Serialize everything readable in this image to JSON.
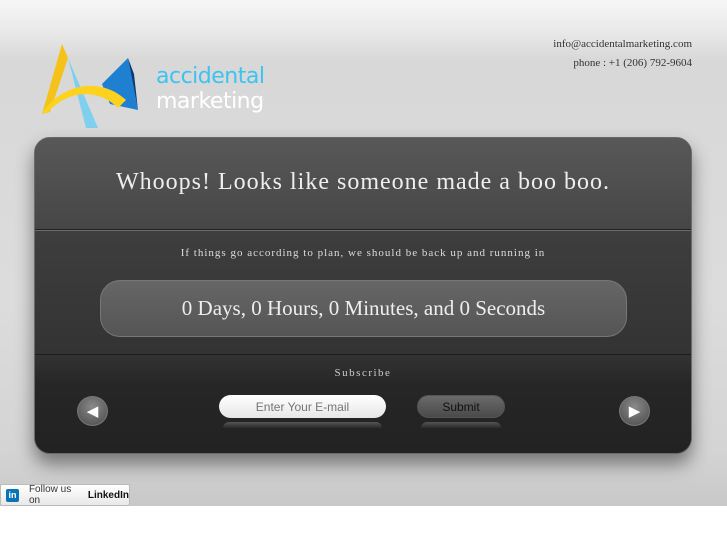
{
  "header": {
    "email": "info@accidentalmarketing.com",
    "phone": "phone : +1 (206) 792-9604"
  },
  "logo": {
    "line1": "accidental",
    "line2": "marketing"
  },
  "main": {
    "title": "Whoops! Looks like someone made a boo boo.",
    "subtitle": "If things go according to plan, we should be back up and running in",
    "countdown": "0 Days, 0 Hours, 0 Minutes, and 0 Seconds",
    "subscribe_label": "Subscribe",
    "email_placeholder": "Enter Your E-mail",
    "submit_label": "Submit",
    "prev_icon": "◀",
    "next_icon": "▶"
  },
  "linkedin": {
    "icon": "in",
    "text": "Follow us on",
    "brand": "LinkedIn"
  }
}
